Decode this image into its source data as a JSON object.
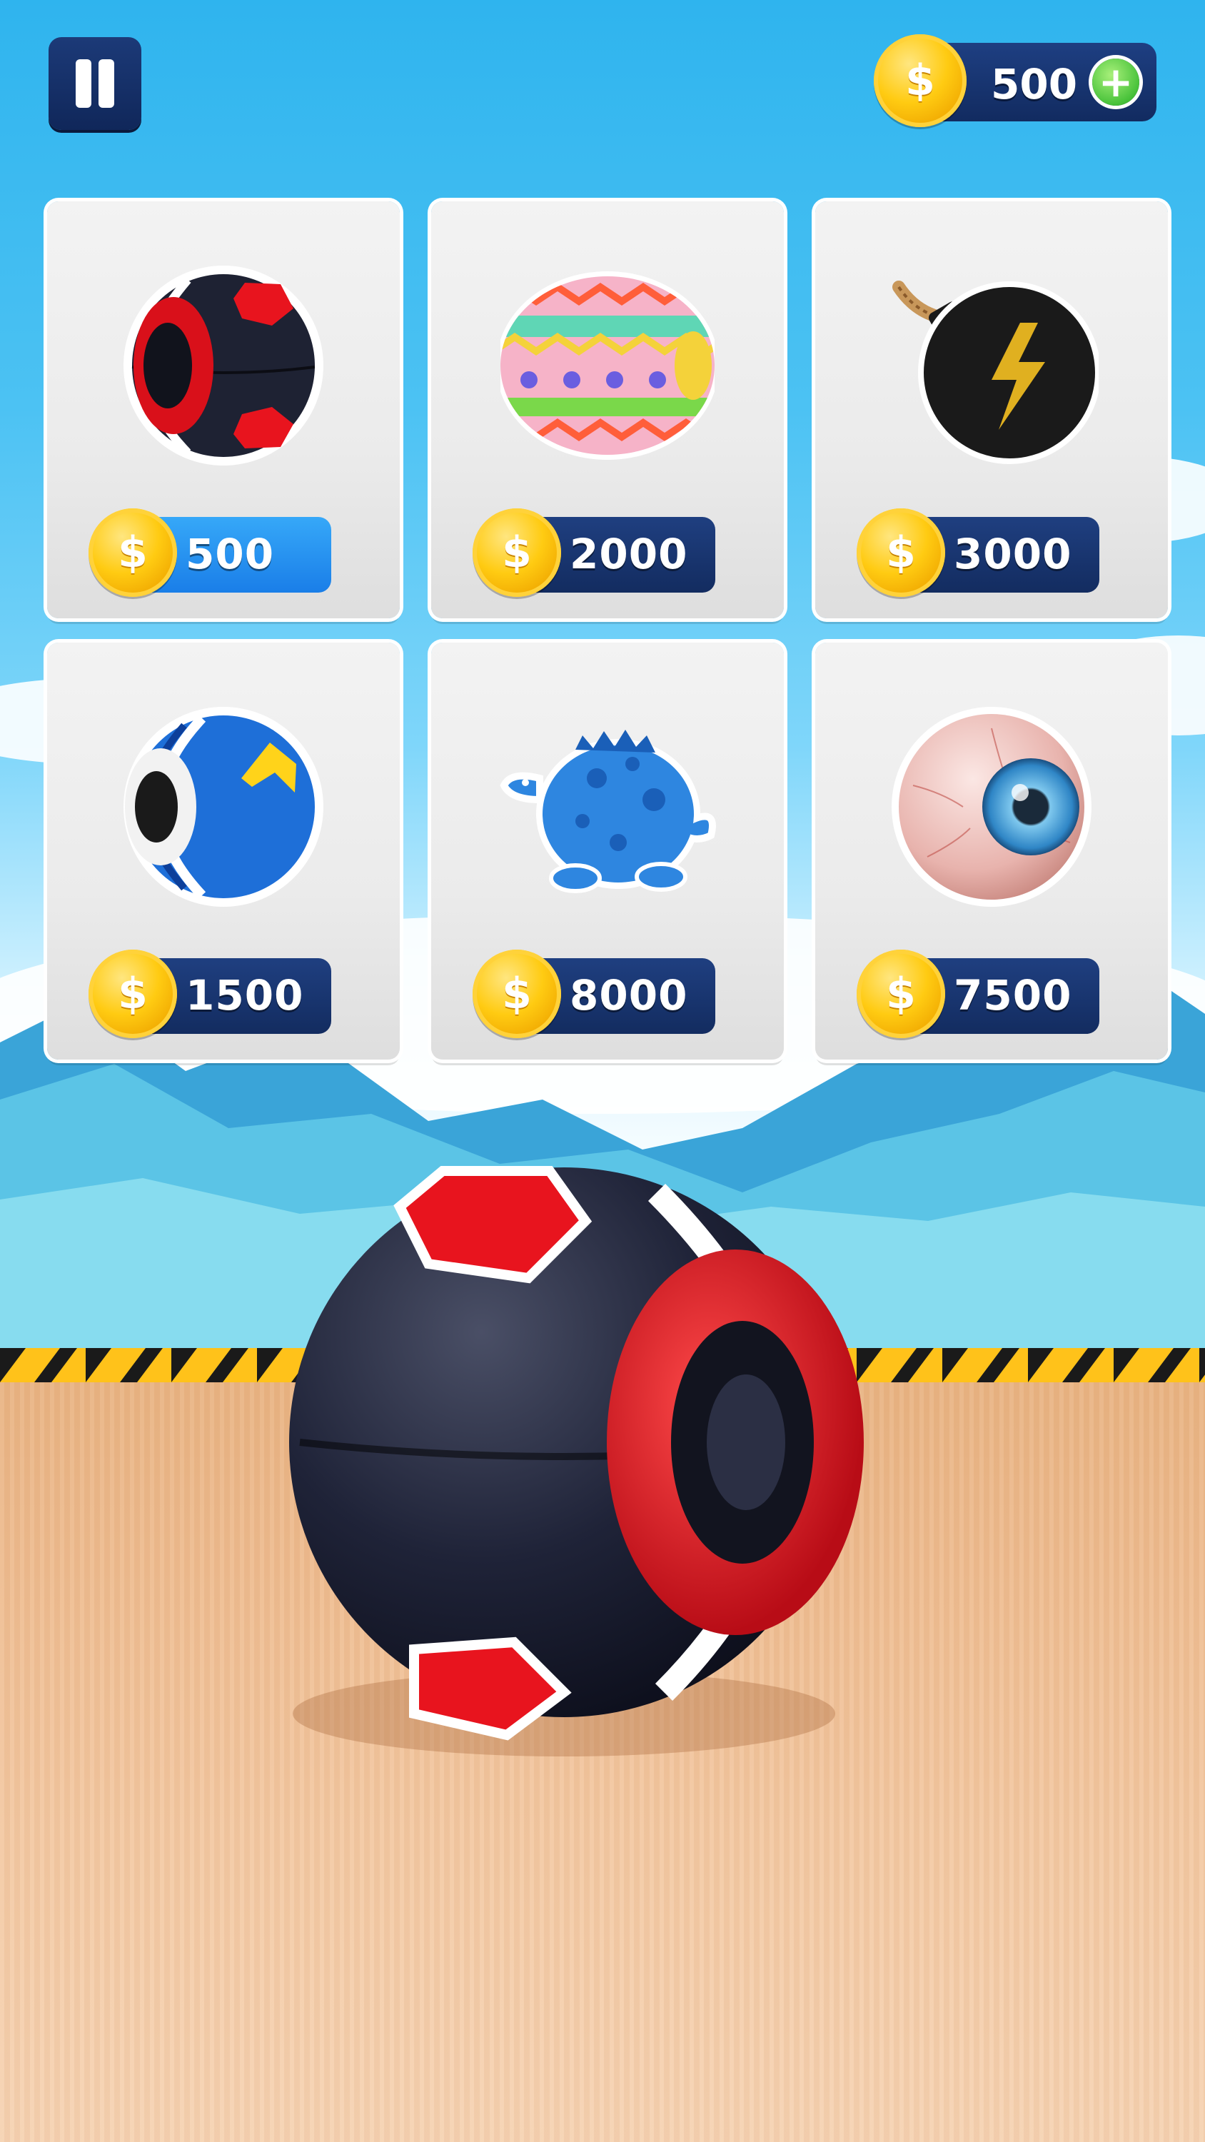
{
  "hud": {
    "coin_symbol": "$",
    "coin_balance": "500",
    "add_coins_symbol": "+"
  },
  "shop": {
    "items": [
      {
        "name": "black-red-ball",
        "price": "500",
        "selected": true
      },
      {
        "name": "easter-egg-ball",
        "price": "2000",
        "selected": false
      },
      {
        "name": "bomb-ball",
        "price": "3000",
        "selected": false
      },
      {
        "name": "blue-yellow-ball",
        "price": "1500",
        "selected": false
      },
      {
        "name": "dinosaur-ball",
        "price": "8000",
        "selected": false
      },
      {
        "name": "eyeball-ball",
        "price": "7500",
        "selected": false
      }
    ]
  },
  "colors": {
    "panel_navy": "#132c60",
    "selected_blue": "#1a7ee8",
    "coin_gold": "#ffcb12",
    "plus_green": "#48c23a"
  }
}
